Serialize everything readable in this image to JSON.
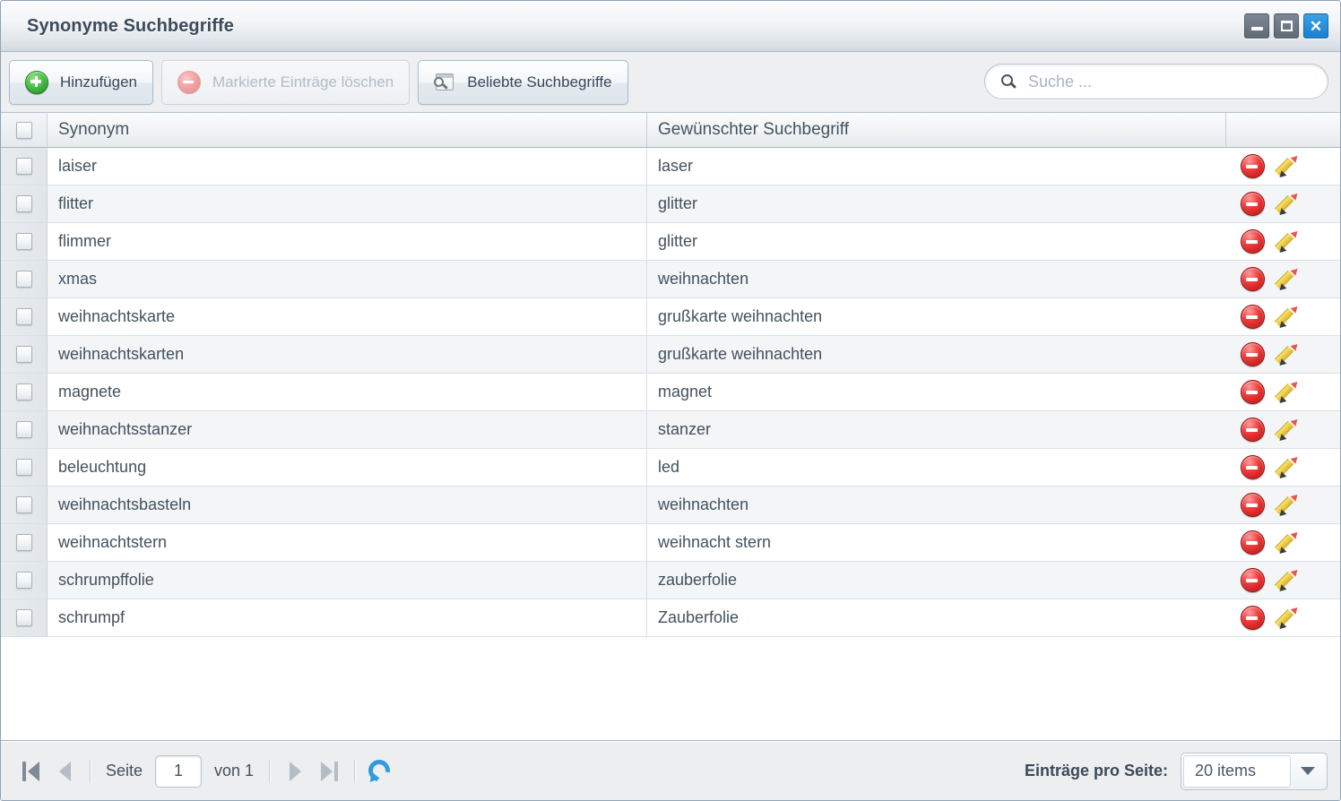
{
  "window": {
    "title": "Synonyme Suchbegriffe",
    "controls": [
      {
        "name": "minimize",
        "glyph": "minimize-icon"
      },
      {
        "name": "maximize",
        "glyph": "maximize-icon"
      },
      {
        "name": "close",
        "glyph": "close-icon",
        "color": "#1a7fcf"
      }
    ]
  },
  "toolbar": {
    "add_label": "Hinzufügen",
    "delete_selected_label": "Markierte Einträge löschen",
    "popular_terms_label": "Beliebte Suchbegriffe",
    "delete_selected_disabled": true,
    "search": {
      "value": "",
      "placeholder": "Suche ..."
    }
  },
  "grid": {
    "columns": [
      "Synonym",
      "Gewünschter Suchbegriff",
      ""
    ],
    "rows": [
      {
        "synonym": "laiser",
        "term": "laser"
      },
      {
        "synonym": "flitter",
        "term": "glitter"
      },
      {
        "synonym": "flimmer",
        "term": "glitter"
      },
      {
        "synonym": "xmas",
        "term": "weihnachten"
      },
      {
        "synonym": "weihnachtskarte",
        "term": "grußkarte weihnachten"
      },
      {
        "synonym": "weihnachtskarten",
        "term": "grußkarte weihnachten"
      },
      {
        "synonym": "magnete",
        "term": "magnet"
      },
      {
        "synonym": "weihnachtsstanzer",
        "term": "stanzer"
      },
      {
        "synonym": "beleuchtung",
        "term": "led"
      },
      {
        "synonym": "weihnachtsbasteln",
        "term": "weihnachten"
      },
      {
        "synonym": "weihnachtstern",
        "term": "weihnacht stern"
      },
      {
        "synonym": "schrumpffolie",
        "term": "zauberfolie"
      },
      {
        "synonym": "schrumpf",
        "term": "Zauberfolie"
      }
    ]
  },
  "footer": {
    "page_label": "Seite",
    "page_value": "1",
    "of_label": "von 1",
    "items_per_page_label": "Einträge pro Seite:",
    "items_per_page_value": "20 items"
  }
}
